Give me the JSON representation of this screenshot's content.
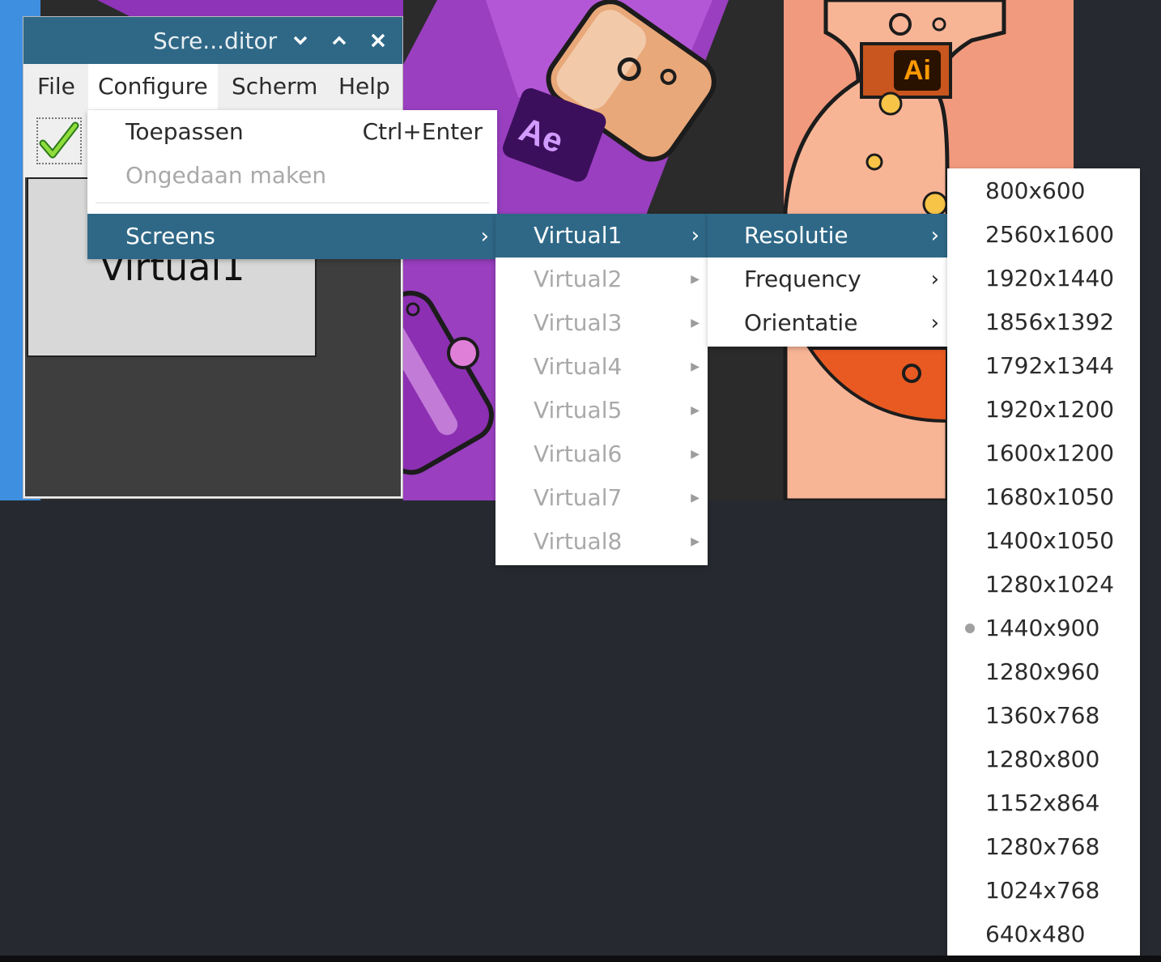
{
  "window": {
    "title": "Scre...ditor",
    "controls": [
      "chevron-down-icon",
      "chevron-up-icon",
      "close-icon"
    ]
  },
  "menubar": [
    "File",
    "Configure",
    "Scherm",
    "Help"
  ],
  "toolbar": {
    "apply_icon": "checkmark-icon"
  },
  "screen_area": {
    "screen_label": "Virtual1"
  },
  "configure_menu": {
    "items": [
      {
        "label": "Toepassen",
        "shortcut": "Ctrl+Enter",
        "enabled": true
      },
      {
        "label": "Ongedaan maken",
        "enabled": false
      },
      {
        "label": "Screens",
        "submenu": true,
        "highlighted": true
      }
    ]
  },
  "screens_menu": {
    "items": [
      {
        "label": "Virtual1",
        "highlighted": true
      },
      {
        "label": "Virtual2"
      },
      {
        "label": "Virtual3"
      },
      {
        "label": "Virtual4"
      },
      {
        "label": "Virtual5"
      },
      {
        "label": "Virtual6"
      },
      {
        "label": "Virtual7"
      },
      {
        "label": "Virtual8"
      }
    ]
  },
  "virtual1_menu": {
    "items": [
      {
        "label": "Resolutie",
        "highlighted": true
      },
      {
        "label": "Frequency"
      },
      {
        "label": "Orientatie"
      }
    ]
  },
  "resolution_menu": {
    "selected": "1440x900",
    "items": [
      "800x600",
      "2560x1600",
      "1920x1440",
      "1856x1392",
      "1792x1344",
      "1920x1200",
      "1600x1200",
      "1680x1050",
      "1400x1050",
      "1280x1024",
      "1440x900",
      "1280x960",
      "1360x768",
      "1280x800",
      "1152x864",
      "1280x768",
      "1024x768",
      "640x480"
    ]
  },
  "wallpaper": {
    "ae_label": "Ae",
    "ai_label": "Ai"
  },
  "colors": {
    "accent": "#2f6887",
    "desktop": "#262a30",
    "disabled_text": "#a9a9a9"
  }
}
